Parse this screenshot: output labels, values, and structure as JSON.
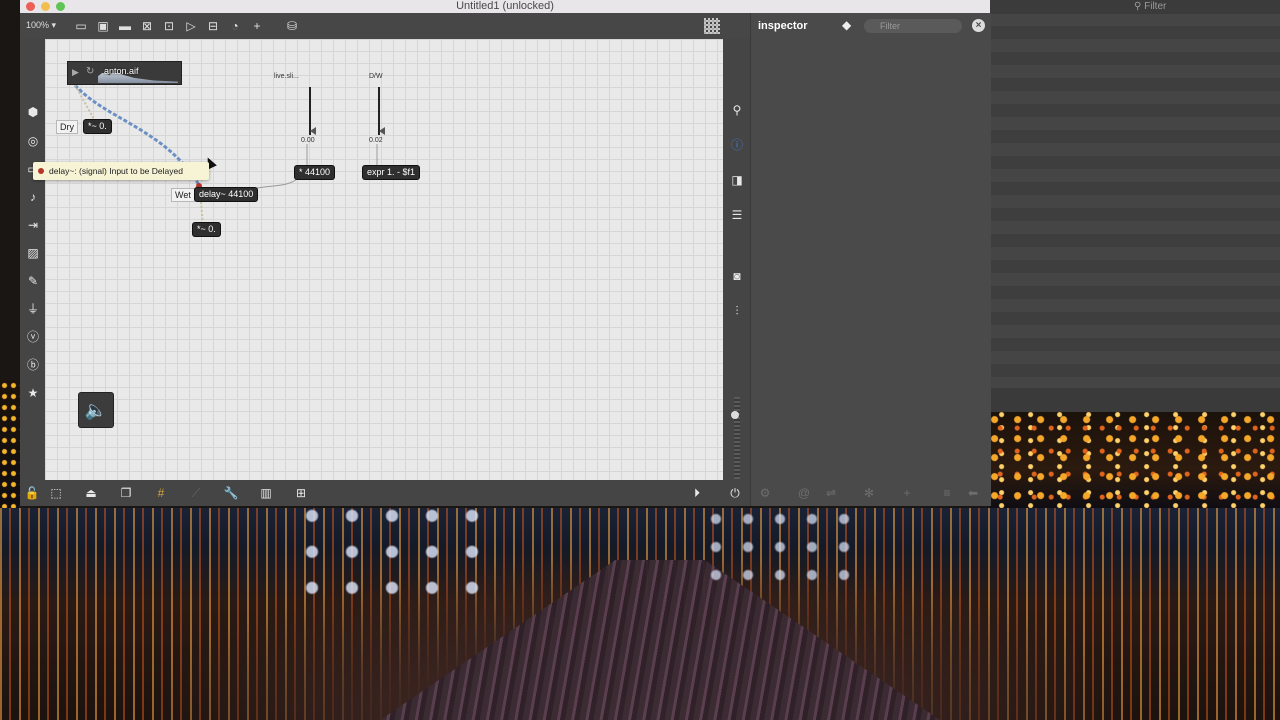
{
  "window": {
    "title": "Untitled1 (unlocked)"
  },
  "toolbar": {
    "zoom": "100%",
    "icons": [
      "presentation-icon",
      "snapshot-icon",
      "comment-icon",
      "message-icon",
      "object-icon",
      "toggle-icon",
      "slider-icon",
      "dial-icon",
      "add-icon",
      "paint-bucket-icon",
      "grid-icon"
    ]
  },
  "patch": {
    "sfplay_file": "anton.aif",
    "dry_label": "Dry",
    "wet_label": "Wet",
    "dry_gain": "*~ 0.",
    "delay_obj": "delay~ 44100",
    "wet_gain": "*~ 0.",
    "mul_obj": "* 44100",
    "expr_obj": "expr 1. - $f1",
    "slider1_label": "live.sli...",
    "slider1_value": "0.00",
    "slider2_label": "D/W",
    "slider2_value": "0.02",
    "tooltip": "delay~: (signal) Input to be Delayed"
  },
  "inspector": {
    "title": "inspector",
    "filter_placeholder": "Filter"
  },
  "background_window": {
    "filter_label": "Filter"
  },
  "colors": {
    "accent_blue": "#3b7fd6",
    "patch_cord": "#6c8fc4",
    "tooltip_bg": "#f7f4d6",
    "close_red": "#ec5f57",
    "minimize_yellow": "#f2be4e",
    "zoom_green": "#5fc453"
  }
}
